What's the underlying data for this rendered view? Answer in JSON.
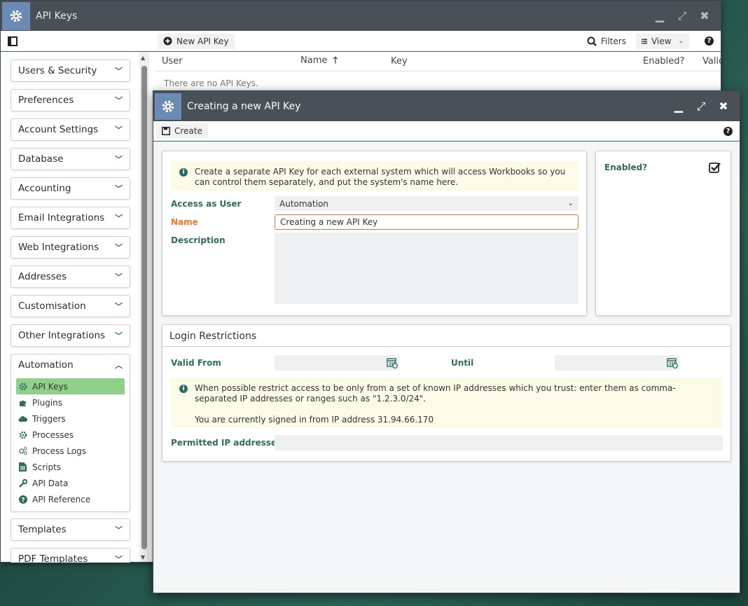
{
  "main_window": {
    "title": "API Keys",
    "toolbar": {
      "new_key_label": "New API Key",
      "filters_label": "Filters",
      "view_label": "View"
    },
    "grid": {
      "columns": [
        "User",
        "Name",
        "Key",
        "Enabled?",
        "Valid"
      ],
      "empty_text": "There are no API Keys."
    }
  },
  "sidebar": {
    "groups_top": [
      {
        "label": "Users & Security"
      },
      {
        "label": "Preferences"
      },
      {
        "label": "Account Settings"
      },
      {
        "label": "Database"
      },
      {
        "label": "Accounting"
      },
      {
        "label": "Email Integrations"
      },
      {
        "label": "Web Integrations"
      },
      {
        "label": "Addresses"
      },
      {
        "label": "Customisation"
      },
      {
        "label": "Other Integrations"
      }
    ],
    "expanded_group": {
      "label": "Automation",
      "items": [
        {
          "label": "API Keys",
          "icon": "gear-icon"
        },
        {
          "label": "Plugins",
          "icon": "puzzle-icon"
        },
        {
          "label": "Triggers",
          "icon": "cloud-icon"
        },
        {
          "label": "Processes",
          "icon": "gear-icon"
        },
        {
          "label": "Process Logs",
          "icon": "gears-icon"
        },
        {
          "label": "Scripts",
          "icon": "document-icon"
        },
        {
          "label": "API Data",
          "icon": "wrench-icon"
        },
        {
          "label": "API Reference",
          "icon": "question-icon"
        }
      ]
    },
    "groups_bottom": [
      {
        "label": "Templates"
      },
      {
        "label": "PDF Templates"
      }
    ]
  },
  "dialog": {
    "title": "Creating a new API Key",
    "toolbar": {
      "create_label": "Create"
    },
    "info_text": "Create a separate API Key for each external system which will access Workbooks so you can control them separately, and put the system's name here.",
    "form": {
      "access_as_user_label": "Access as User",
      "access_as_user_value": "Automation",
      "name_label": "Name",
      "name_value": "Creating a new API Key",
      "description_label": "Description",
      "description_value": ""
    },
    "enabled": {
      "label": "Enabled?",
      "checked": true
    },
    "login_restrictions": {
      "title": "Login Restrictions",
      "valid_from_label": "Valid From",
      "valid_from_value": "",
      "until_label": "Until",
      "until_value": "",
      "info_line1": "When possible restrict access to be only from a set of known IP addresses which you trust: enter them as comma-separated IP addresses or ranges such as \"1.2.3.0/24\".",
      "info_line2": "You are currently signed in from IP address 31.94.66.170",
      "permitted_ip_label": "Permitted IP addresses",
      "permitted_ip_value": ""
    }
  },
  "colors": {
    "brand_green": "#2f6b5e",
    "active_item": "#8fd08a",
    "required_orange": "#e8762b",
    "titlebar": "#4a5058"
  }
}
